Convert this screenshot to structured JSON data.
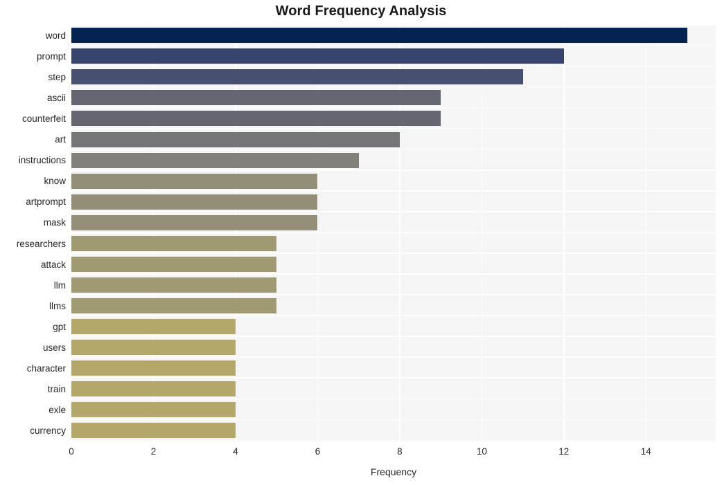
{
  "chart_data": {
    "type": "bar",
    "orientation": "horizontal",
    "title": "Word Frequency Analysis",
    "xlabel": "Frequency",
    "ylabel": "",
    "categories": [
      "word",
      "prompt",
      "step",
      "ascii",
      "counterfeit",
      "art",
      "instructions",
      "know",
      "artprompt",
      "mask",
      "researchers",
      "attack",
      "llm",
      "llms",
      "gpt",
      "users",
      "character",
      "train",
      "exle",
      "currency"
    ],
    "values": [
      15,
      12,
      11,
      9,
      9,
      8,
      7,
      6,
      6,
      6,
      5,
      5,
      5,
      5,
      4,
      4,
      4,
      4,
      4,
      4
    ],
    "xlim": [
      0,
      15.7
    ],
    "xticks": [
      0,
      2,
      4,
      6,
      8,
      10,
      12,
      14
    ],
    "xtick_labels": [
      "0",
      "2",
      "4",
      "6",
      "8",
      "10",
      "12",
      "14"
    ],
    "grid": "vertical-only",
    "legend": "none",
    "bar_colors": [
      "#04244f",
      "#36446f",
      "#474f6e",
      "#646670",
      "#646670",
      "#75757a",
      "#83817c",
      "#938e78",
      "#938e78",
      "#948f79",
      "#a09a72",
      "#a09a72",
      "#a09a72",
      "#a09a72",
      "#b3a86a",
      "#b3a86a",
      "#b3a86a",
      "#b3a86a",
      "#b3a86a",
      "#b3a86a"
    ],
    "plot_background": "#f5f5f5",
    "gridline_color": "#ffffff",
    "figure_background": "#ffffff",
    "title_color": "#1a1a1a",
    "tick_label_color": "#262626"
  }
}
